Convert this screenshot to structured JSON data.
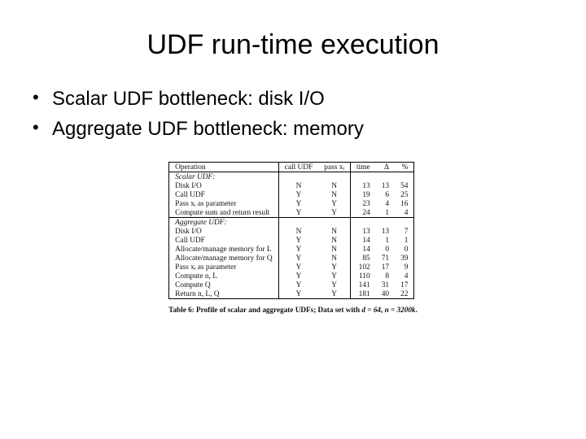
{
  "title": "UDF run-time execution",
  "bullets": {
    "b1": "Scalar UDF bottleneck: disk I/O",
    "b2": "Aggregate UDF bottleneck: memory"
  },
  "headers": {
    "op": "Operation",
    "call": "call UDF",
    "pass": "pass xᵢ",
    "time": "time",
    "delta": "Δ",
    "pct": "%"
  },
  "sections": {
    "scalar": "Scalar UDF:",
    "aggregate": "Aggregate UDF:"
  },
  "scalar_rows": [
    {
      "op": "Disk I/O",
      "call": "N",
      "pass": "N",
      "time": "13",
      "delta": "13",
      "pct": "54"
    },
    {
      "op": "Call UDF",
      "call": "Y",
      "pass": "N",
      "time": "19",
      "delta": "6",
      "pct": "25"
    },
    {
      "op": "Pass xᵢ as parameter",
      "call": "Y",
      "pass": "Y",
      "time": "23",
      "delta": "4",
      "pct": "16"
    },
    {
      "op": "Compute sum and return result",
      "call": "Y",
      "pass": "Y",
      "time": "24",
      "delta": "1",
      "pct": "4"
    }
  ],
  "agg_rows": [
    {
      "op": "Disk I/O",
      "call": "N",
      "pass": "N",
      "time": "13",
      "delta": "13",
      "pct": "7"
    },
    {
      "op": "Call UDF",
      "call": "Y",
      "pass": "N",
      "time": "14",
      "delta": "1",
      "pct": "1"
    },
    {
      "op": "Allocate/manage memory for L",
      "call": "Y",
      "pass": "N",
      "time": "14",
      "delta": "0",
      "pct": "0"
    },
    {
      "op": "Allocate/manage memory for Q",
      "call": "Y",
      "pass": "N",
      "time": "85",
      "delta": "71",
      "pct": "39"
    },
    {
      "op": "Pass xᵢ as parameter",
      "call": "Y",
      "pass": "Y",
      "time": "102",
      "delta": "17",
      "pct": "9"
    },
    {
      "op": "Compute n, L",
      "call": "Y",
      "pass": "Y",
      "time": "110",
      "delta": "8",
      "pct": "4"
    },
    {
      "op": "Compute Q",
      "call": "Y",
      "pass": "Y",
      "time": "141",
      "delta": "31",
      "pct": "17"
    },
    {
      "op": "Return n, L, Q",
      "call": "Y",
      "pass": "Y",
      "time": "181",
      "delta": "40",
      "pct": "22"
    }
  ],
  "caption_prefix": "Table 6: Profile of scalar and aggregate UDFs; Data set with ",
  "caption_d": "d = 64",
  "caption_comma": ", ",
  "caption_n": "n = 3200k",
  "caption_period": "."
}
